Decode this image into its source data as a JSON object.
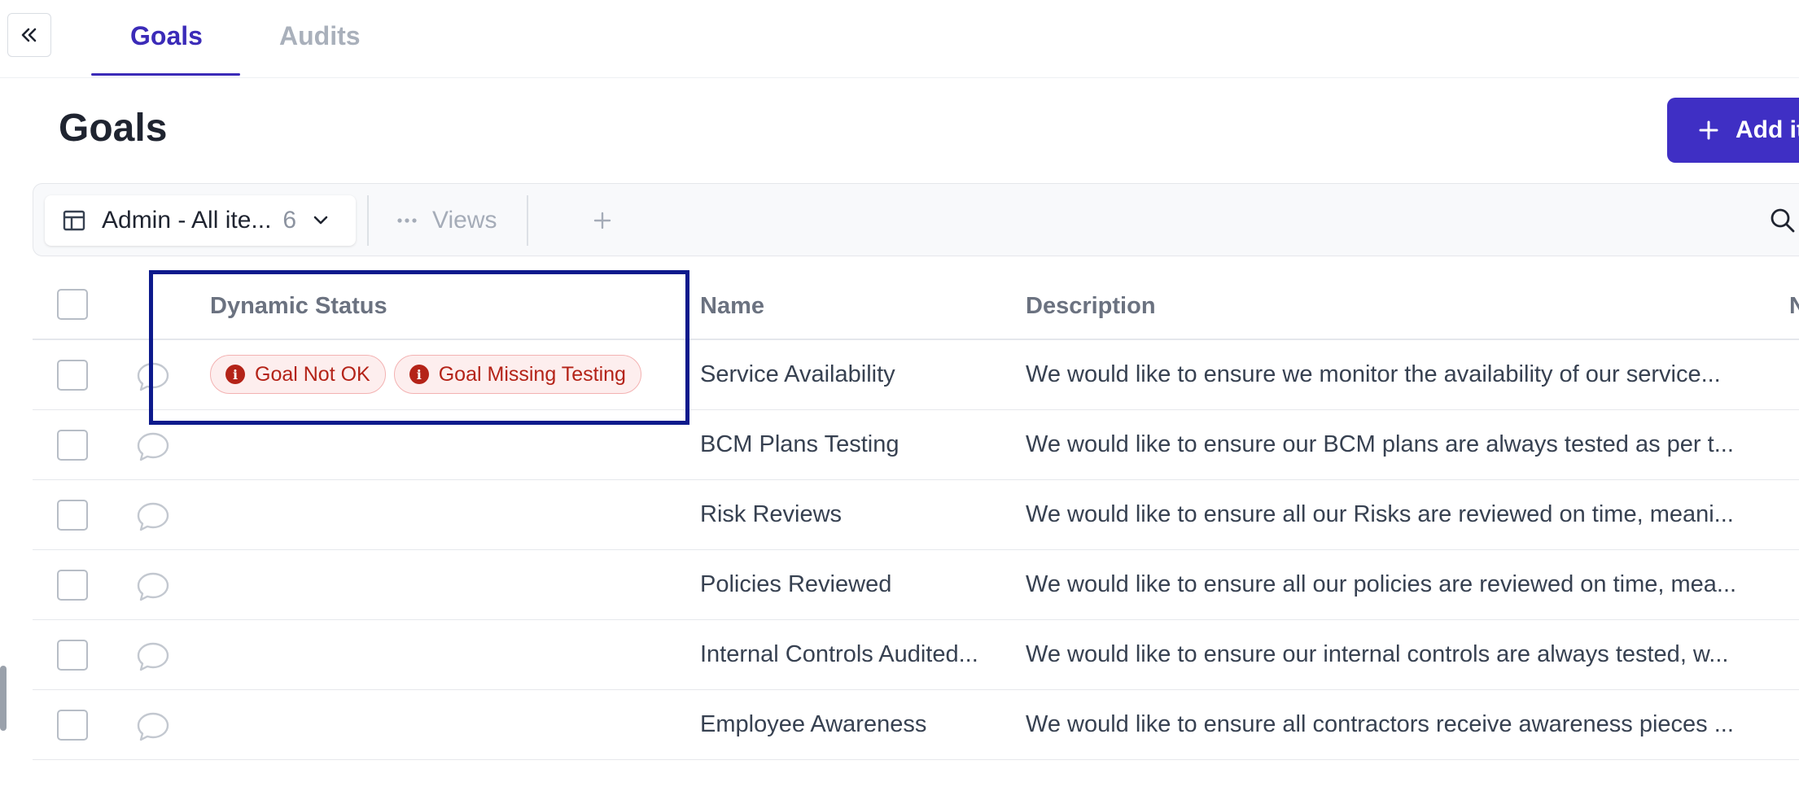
{
  "tabs": [
    {
      "label": "Goals",
      "active": true
    },
    {
      "label": "Audits",
      "active": false
    }
  ],
  "page": {
    "title": "Goals",
    "add_button_label": "Add it"
  },
  "toolbar": {
    "view_label": "Admin - All ite...",
    "view_count": "6",
    "views_label": "Views"
  },
  "table": {
    "columns": [
      "Dynamic Status",
      "Name",
      "Description",
      "N"
    ],
    "rows": [
      {
        "status": [
          "Goal Not OK",
          "Goal Missing Testing"
        ],
        "name": "Service Availability",
        "description": "We would like to ensure we monitor the availability of our service..."
      },
      {
        "status": [],
        "name": "BCM Plans Testing",
        "description": "We would like to ensure our BCM plans are always tested as per t..."
      },
      {
        "status": [],
        "name": "Risk Reviews",
        "description": "We would like to ensure all our Risks are reviewed on time, meani..."
      },
      {
        "status": [],
        "name": "Policies Reviewed",
        "description": "We would like to ensure all our policies are reviewed on time, mea..."
      },
      {
        "status": [],
        "name": "Internal Controls Audited...",
        "description": "We would like to ensure our internal controls are always tested, w..."
      },
      {
        "status": [],
        "name": "Employee Awareness",
        "description": "We would like to ensure all contractors receive awareness pieces ..."
      }
    ]
  },
  "colors": {
    "accent": "#3f2fc4",
    "badge_text": "#b42318",
    "badge_bg": "#fdeeee",
    "highlight": "#0d1a8c"
  }
}
